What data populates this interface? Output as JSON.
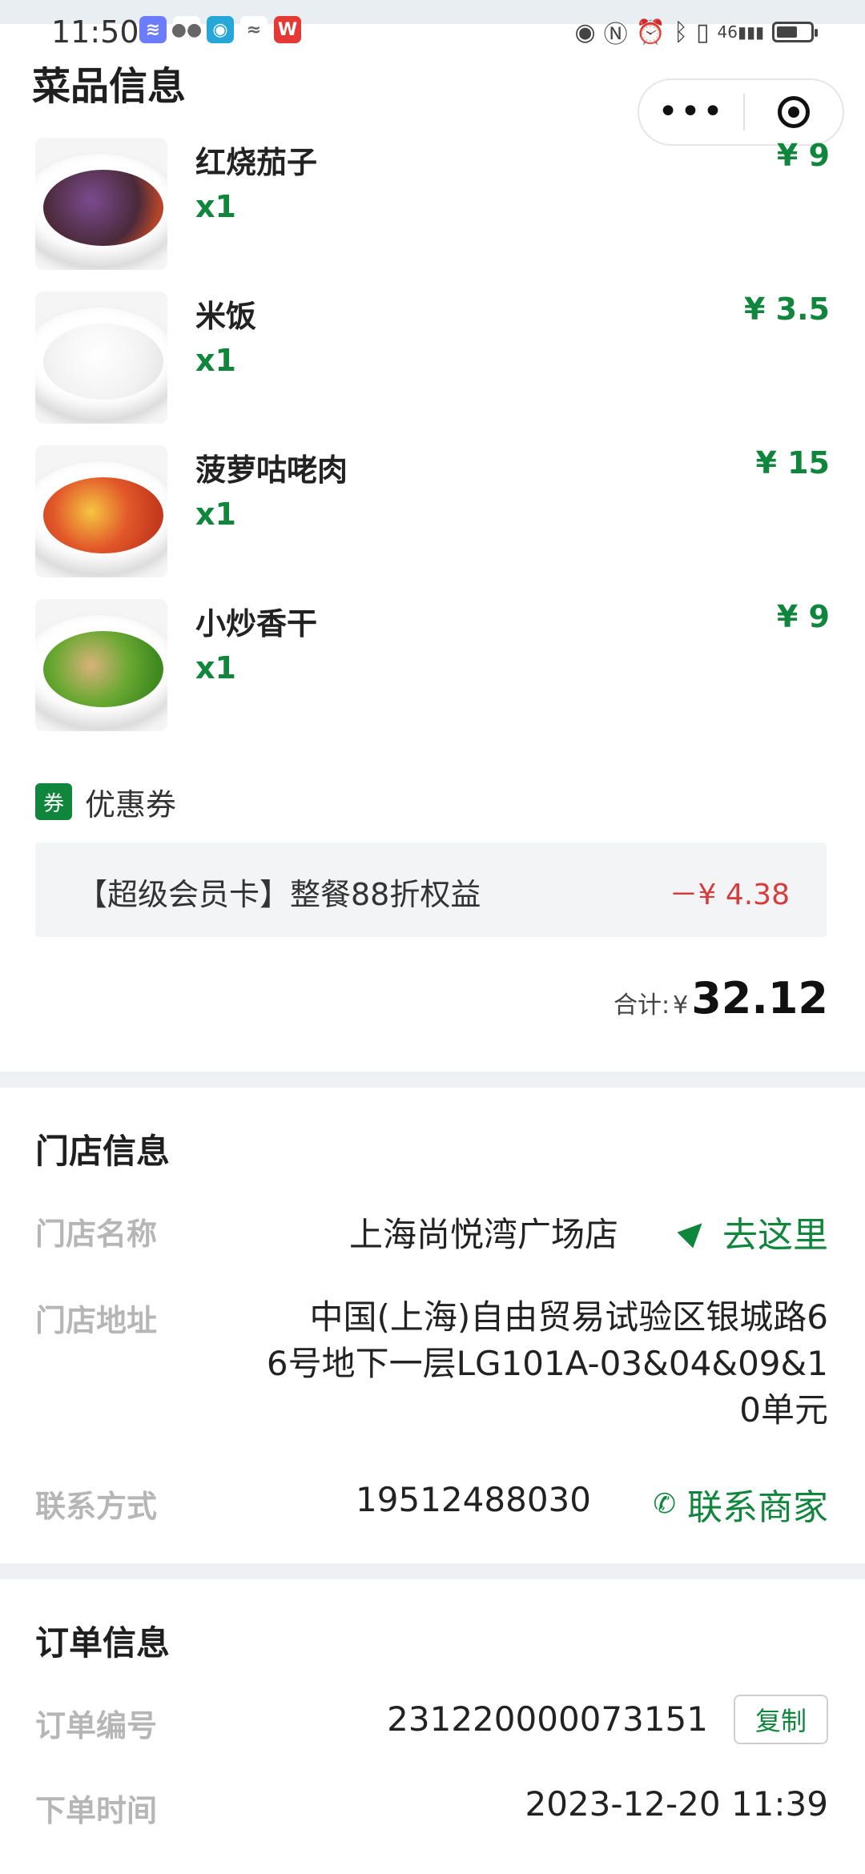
{
  "status_bar": {
    "time": "11:50",
    "right_icons": [
      "eye-icon",
      "nfc-icon",
      "alarm-icon",
      "bluetooth-icon",
      "vibrate-icon",
      "signal-icon",
      "battery-icon"
    ],
    "network": "46"
  },
  "dishes": {
    "title": "菜品信息",
    "items": [
      {
        "name": "红烧茄子",
        "qty": "x1",
        "price": "¥ 9"
      },
      {
        "name": "米饭",
        "qty": "x1",
        "price": "¥ 3.5"
      },
      {
        "name": "菠萝咕咾肉",
        "qty": "x1",
        "price": "¥ 15"
      },
      {
        "name": "小炒香干",
        "qty": "x1",
        "price": "¥ 9"
      }
    ]
  },
  "capsule": {
    "more": "•••"
  },
  "coupon": {
    "tag": "券",
    "title": "优惠券",
    "name": "【超级会员卡】整餐88折权益",
    "amount": "－¥ 4.38"
  },
  "total": {
    "label": "合计:",
    "currency": "¥",
    "value": "32.12"
  },
  "store": {
    "title": "门店信息",
    "name_label": "门店名称",
    "name_value": "上海尚悦湾广场店",
    "go_label": "去这里",
    "address_label": "门店地址",
    "address_line1": "中国(上海)自由贸易试验区银城路6",
    "address_line2": "6号地下一层LG101A-03&04&09&1",
    "address_line3": "0单元",
    "contact_label": "联系方式",
    "phone": "19512488030",
    "contact_link": "联系商家"
  },
  "order": {
    "title": "订单信息",
    "number_label": "订单编号",
    "number": "231220000073151",
    "copy_label": "复制",
    "time_label": "下单时间",
    "time": "2023-12-20 11:39"
  },
  "colors": {
    "accent": "#10863d",
    "discount": "#d93b3b",
    "label_gray": "#b6b6b6"
  }
}
